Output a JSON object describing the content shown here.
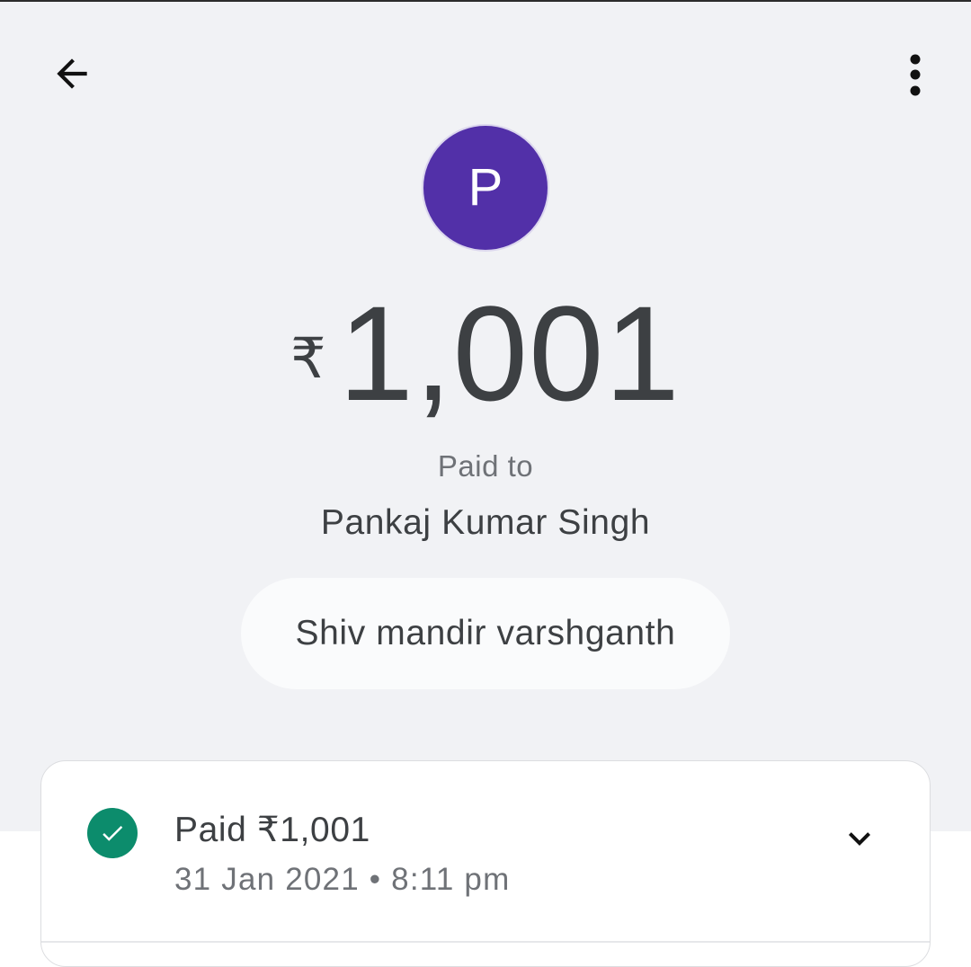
{
  "colors": {
    "avatar_bg": "#5230a8",
    "success": "#0c8c6c",
    "page_bg": "#f1f2f5",
    "text_primary": "#3d4043",
    "text_secondary": "#6f7277"
  },
  "header": {
    "back_icon": "arrow-left-icon",
    "more_icon": "more-vertical-icon"
  },
  "recipient": {
    "avatar_letter": "P",
    "paid_to_label": "Paid to",
    "name": "Pankaj Kumar Singh"
  },
  "amount": {
    "currency_symbol": "₹",
    "value": "1,001"
  },
  "note": "Shiv mandir varshganth",
  "status": {
    "icon": "check-circle-icon",
    "title": "Paid ₹1,001",
    "datetime": "31 Jan 2021 • 8:11 pm",
    "expand_icon": "chevron-down-icon"
  }
}
